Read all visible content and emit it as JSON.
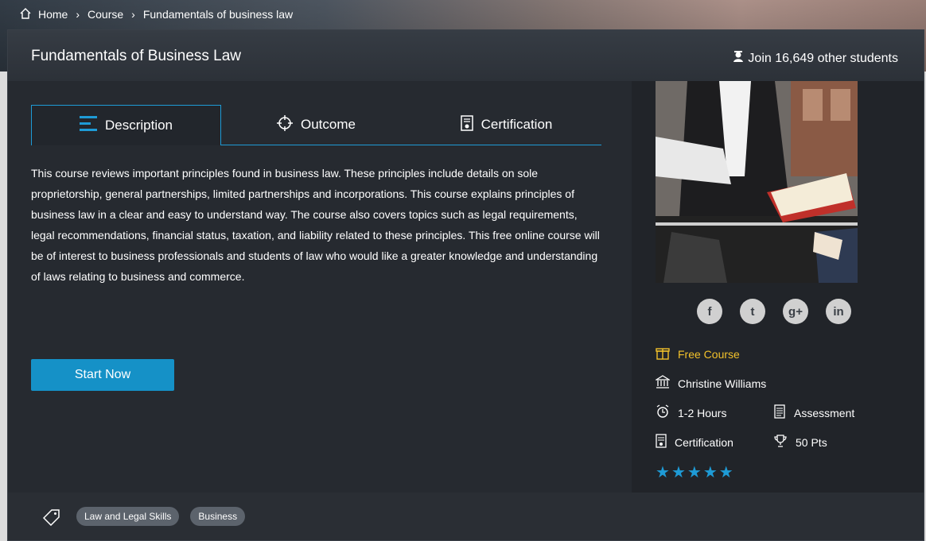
{
  "breadcrumb": {
    "home": "Home",
    "course": "Course",
    "current": "Fundamentals of business law"
  },
  "course": {
    "title": "Fundamentals of Business Law",
    "join": "Join 16,649 other students",
    "start_label": "Start Now"
  },
  "tabs": [
    {
      "label": "Description",
      "icon": "list-icon"
    },
    {
      "label": "Outcome",
      "icon": "target-icon"
    },
    {
      "label": "Certification",
      "icon": "certificate-icon"
    }
  ],
  "description": "This course reviews important principles found in business law. These principles include details on sole proprietorship, general partnerships, limited partnerships and incorporations. This course explains principles of business law in a clear and easy to understand way. The course also covers topics such as legal requirements, legal recommendations, financial status, taxation, and liability related to these principles. This free online course will be of interest to business professionals and students of law who would like a greater knowledge and understanding of laws relating to business and commerce.",
  "social": [
    {
      "icon": "facebook-icon",
      "glyph": "f"
    },
    {
      "icon": "twitter-icon",
      "glyph": "t"
    },
    {
      "icon": "google-plus-icon",
      "glyph": "g+"
    },
    {
      "icon": "linkedin-icon",
      "glyph": "in"
    }
  ],
  "meta": {
    "price": "Free Course",
    "instructor": "Christine Williams",
    "duration": "1-2 Hours",
    "assessment": "Assessment",
    "certification": "Certification",
    "points": "50 Pts",
    "rating": 5
  },
  "tags": [
    "Law and Legal Skills",
    "Business"
  ],
  "colors": {
    "accent": "#1e9bd6",
    "button": "#1591c7",
    "free": "#f3c22b"
  }
}
